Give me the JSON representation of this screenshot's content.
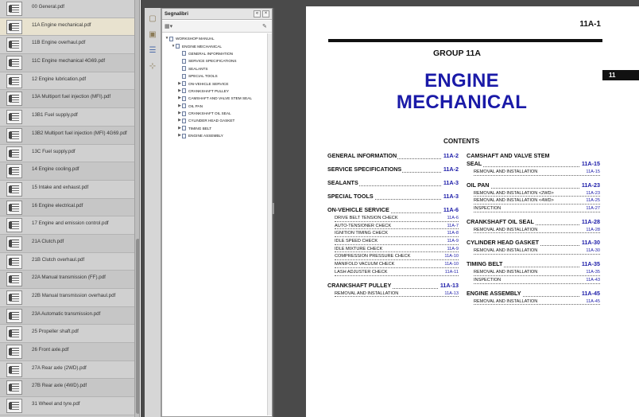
{
  "files": [
    {
      "name": "00 General.pdf",
      "selected": false
    },
    {
      "name": "11A Engine mechanical.pdf",
      "selected": true
    },
    {
      "name": "11B Engine overhaul.pdf",
      "selected": false
    },
    {
      "name": "11C Engine mechanical 4G69.pdf",
      "selected": false
    },
    {
      "name": "12 Engine lubrication.pdf",
      "selected": false
    },
    {
      "name": "13A Multiport fuel injection (MFI).pdf",
      "selected": false
    },
    {
      "name": "13B1 Fuel supply.pdf",
      "selected": false
    },
    {
      "name": "13B2 Multiport fuel injection (MFI) 4G69.pdf",
      "selected": false
    },
    {
      "name": "13C Fuel supply.pdf",
      "selected": false
    },
    {
      "name": "14 Engine cooling.pdf",
      "selected": false
    },
    {
      "name": "15 Intake and exhaust.pdf",
      "selected": false
    },
    {
      "name": "16 Engine electrical.pdf",
      "selected": false
    },
    {
      "name": "17 Engine and emission control.pdf",
      "selected": false
    },
    {
      "name": "21A Clutch.pdf",
      "selected": false
    },
    {
      "name": "21B Clutch overhaul.pdf",
      "selected": false
    },
    {
      "name": "22A Manual transmission (FF).pdf",
      "selected": false
    },
    {
      "name": "22B Manual transmission overhaul.pdf",
      "selected": false
    },
    {
      "name": "23A Automatic transmission.pdf",
      "selected": false
    },
    {
      "name": "25 Propeller shaft.pdf",
      "selected": false
    },
    {
      "name": "26 Front axle.pdf",
      "selected": false
    },
    {
      "name": "27A Rear axle (2WD).pdf",
      "selected": false
    },
    {
      "name": "27B Rear axle (4WD).pdf",
      "selected": false
    },
    {
      "name": "31 Wheel and tyre.pdf",
      "selected": false
    }
  ],
  "bookmarks_panel": {
    "title": "Segnalibri",
    "collapse_label": "«",
    "close_label": "×"
  },
  "bookmarks": [
    {
      "label": "WORKSHOP MANUAL",
      "level": 0,
      "arrow": "▼"
    },
    {
      "label": "ENGINE MECHANICAL",
      "level": 1,
      "arrow": "▼"
    },
    {
      "label": "GENERAL INFORMATION",
      "level": 2,
      "arrow": ""
    },
    {
      "label": "SERVICE SPECIFICATIONS",
      "level": 2,
      "arrow": ""
    },
    {
      "label": "SEALANTS",
      "level": 2,
      "arrow": ""
    },
    {
      "label": "SPECIAL TOOLS",
      "level": 2,
      "arrow": ""
    },
    {
      "label": "ON-VEHICLE SERVICE",
      "level": 2,
      "arrow": "▶"
    },
    {
      "label": "CRANKSHAFT PULLEY",
      "level": 2,
      "arrow": "▶"
    },
    {
      "label": "CAMSHAFT AND VALVE STEM SEAL",
      "level": 2,
      "arrow": "▶"
    },
    {
      "label": "OIL PAN",
      "level": 2,
      "arrow": "▶"
    },
    {
      "label": "CRANKSHAFT OIL SEAL",
      "level": 2,
      "arrow": "▶"
    },
    {
      "label": "CYLINDER HEAD GASKET",
      "level": 2,
      "arrow": "▶"
    },
    {
      "label": "TIMING BELT",
      "level": 2,
      "arrow": "▶"
    },
    {
      "label": "ENGINE ASSEMBLY",
      "level": 2,
      "arrow": "▶"
    }
  ],
  "page": {
    "number": "11A-1",
    "group": "GROUP 11A",
    "tab": "11",
    "title_line1": "ENGINE",
    "title_line2": "MECHANICAL",
    "contents_heading": "CONTENTS",
    "toc_left": [
      {
        "title": "GENERAL INFORMATION",
        "page": "11A-2",
        "subs": []
      },
      {
        "title": "SERVICE SPECIFICATIONS",
        "page": "11A-2",
        "subs": []
      },
      {
        "title": "SEALANTS",
        "page": "11A-3",
        "subs": []
      },
      {
        "title": "SPECIAL TOOLS",
        "page": "11A-3",
        "subs": []
      },
      {
        "title": "ON-VEHICLE SERVICE",
        "page": "11A-6",
        "subs": [
          {
            "title": "DRIVE BELT TENSION CHECK",
            "page": "11A-6"
          },
          {
            "title": "AUTO-TENSIONER CHECK",
            "page": "11A-7"
          },
          {
            "title": "IGNITION TIMING CHECK",
            "page": "11A-8"
          },
          {
            "title": "IDLE SPEED CHECK",
            "page": "11A-9"
          },
          {
            "title": "IDLE MIXTURE CHECK",
            "page": "11A-9"
          },
          {
            "title": "COMPRESSION PRESSURE CHECK",
            "page": "11A-10"
          },
          {
            "title": "MANIFOLD VACUUM CHECK",
            "page": "11A-10"
          },
          {
            "title": "LASH ADJUSTER CHECK",
            "page": "11A-11"
          }
        ]
      },
      {
        "title": "CRANKSHAFT PULLEY",
        "page": "11A-13",
        "subs": [
          {
            "title": "REMOVAL AND INSTALLATION",
            "page": "11A-13"
          }
        ]
      }
    ],
    "toc_right": [
      {
        "title": "CAMSHAFT AND VALVE STEM",
        "title2": "SEAL",
        "page": "11A-15",
        "subs": [
          {
            "title": "REMOVAL AND INSTALLATION",
            "page": "11A-15"
          }
        ]
      },
      {
        "title": "OIL PAN",
        "page": "11A-23",
        "subs": [
          {
            "title": "REMOVAL AND INSTALLATION <2WD>",
            "page": "11A-23"
          },
          {
            "title": "REMOVAL AND INSTALLATION <4WD>",
            "page": "11A-25"
          },
          {
            "title": "INSPECTION",
            "page": "11A-27"
          }
        ]
      },
      {
        "title": "CRANKSHAFT OIL SEAL",
        "page": "11A-28",
        "subs": [
          {
            "title": "REMOVAL AND INSTALLATION",
            "page": "11A-28"
          }
        ]
      },
      {
        "title": "CYLINDER HEAD GASKET",
        "page": "11A-30",
        "subs": [
          {
            "title": "REMOVAL AND INSTALLATION",
            "page": "11A-30"
          }
        ]
      },
      {
        "title": "TIMING BELT",
        "page": "11A-35",
        "subs": [
          {
            "title": "REMOVAL AND INSTALLATION",
            "page": "11A-35"
          },
          {
            "title": "INSPECTION",
            "page": "11A-43"
          }
        ]
      },
      {
        "title": "ENGINE ASSEMBLY",
        "page": "11A-45",
        "subs": [
          {
            "title": "REMOVAL AND INSTALLATION",
            "page": "11A-45"
          }
        ]
      }
    ]
  },
  "icons": {
    "nav_pages": "pages-icon",
    "nav_bookmarks": "bookmark-icon",
    "nav_attachments": "paperclip-icon",
    "options": "options-icon",
    "expand": "expand-icon"
  }
}
